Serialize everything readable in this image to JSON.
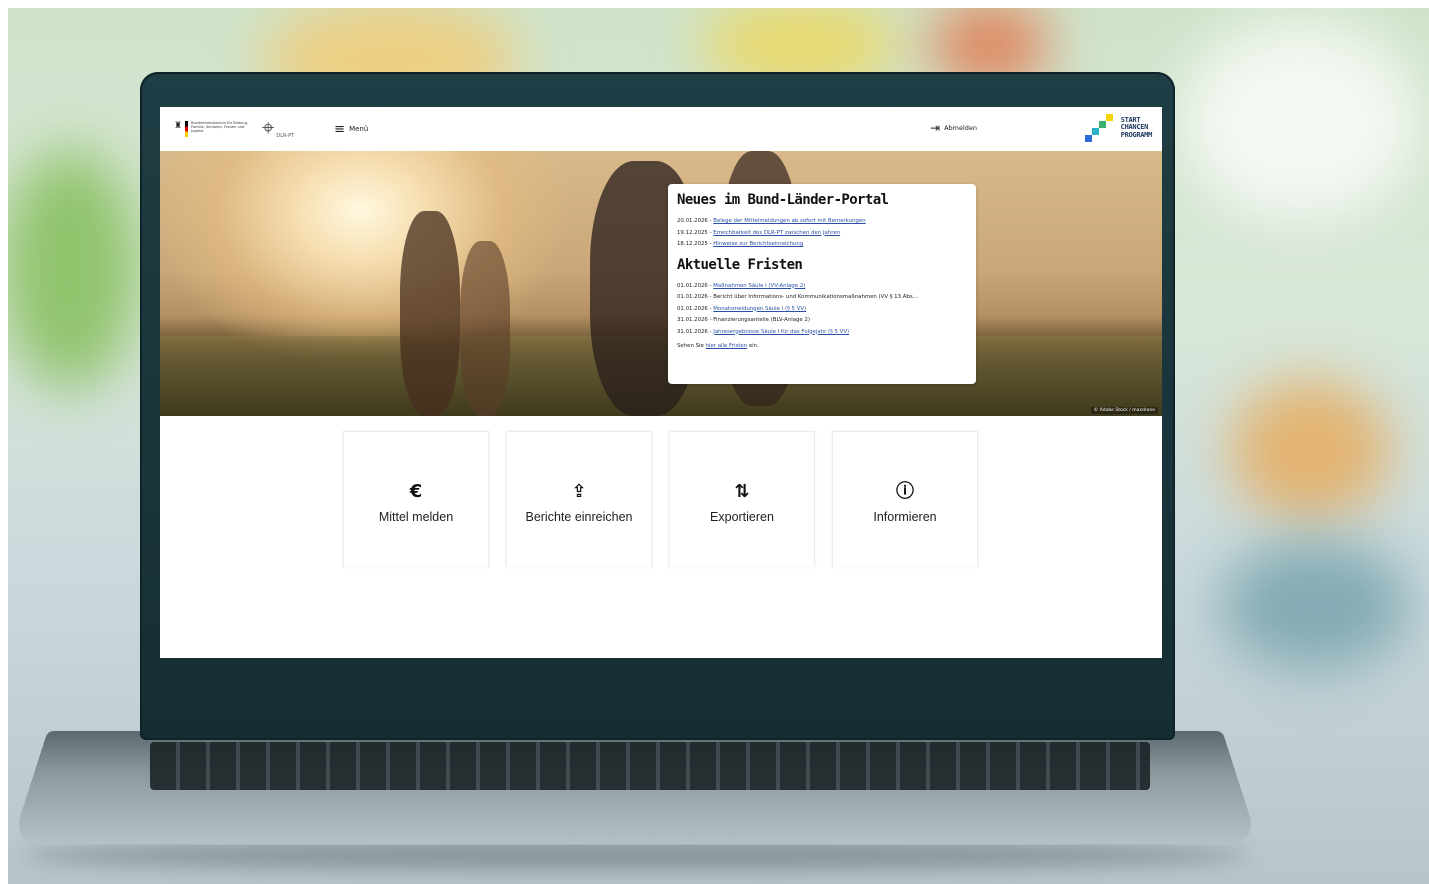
{
  "header": {
    "gov_logo_text": "Bundesministerium für Bildung, Familie, Senioren, Frauen und Jugend",
    "dlr_label": "DLR-PT",
    "menu_label": "Menü",
    "logout_label": "Abmelden",
    "program_logo_lines": [
      "START",
      "CHANCEN",
      "PROGRAMM"
    ]
  },
  "news": {
    "title": "Neues im Bund-Länder-Portal",
    "items": [
      {
        "date": "20.01.2026 - ",
        "text": "Belege der Mittelmeldungen ab sofort mit Bemerkungen"
      },
      {
        "date": "19.12.2025 - ",
        "text": "Erreichbarkeit des DLR-PT zwischen den Jahren"
      },
      {
        "date": "18.12.2025 - ",
        "text": "Hinweise zur Berichtseinreichung"
      }
    ]
  },
  "deadlines": {
    "title": "Aktuelle Fristen",
    "items": [
      {
        "date": "01.01.2026 - ",
        "text": "Maßnahmen Säule I (VV-Anlage 2)",
        "link": true
      },
      {
        "date": "01.01.2026 - ",
        "text": "Bericht über Informations- und Kommunikationsmaßnahmen (VV § 13 Abs...",
        "link": false
      },
      {
        "date": "01.01.2026 - ",
        "text": "Monatsmeldungen Säule I (§ 5 VV)",
        "link": true
      },
      {
        "date": "31.01.2026 - ",
        "text": "Finanzierungsanteile (BLV-Anlage 2)",
        "link": false
      },
      {
        "date": "31.01.2026 - ",
        "text": "Jahresergebnisse Säule I für das Folgejahr (§ 5 VV)",
        "link": true
      }
    ],
    "see_all_prefix": "Sehen Sie ",
    "see_all_link": "hier alle Fristen",
    "see_all_suffix": " ein."
  },
  "hero": {
    "copyright": "© Adobe Stock / maxdrone"
  },
  "tiles": [
    {
      "icon": "euro-icon",
      "glyph": "€",
      "label": "Mittel melden"
    },
    {
      "icon": "upload-icon",
      "glyph": "⇪",
      "label": "Berichte einreichen"
    },
    {
      "icon": "swap-vertical-icon",
      "glyph": "⇅",
      "label": "Exportieren"
    },
    {
      "icon": "info-icon",
      "glyph": "ⓘ",
      "label": "Informieren"
    }
  ],
  "colors": {
    "link": "#2a4fa8",
    "laptop_bezel": "#1f3d44",
    "program_yellow": "#f5d400",
    "program_green": "#3bb26b",
    "program_blue": "#2b6bd6",
    "program_teal": "#27b3c4"
  }
}
